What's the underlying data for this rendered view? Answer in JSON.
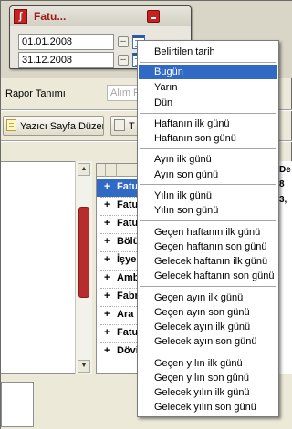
{
  "floating_window": {
    "title": "Fatu...",
    "date_from": "01.01.2008",
    "date_to": "31.12.2008",
    "dots": "..."
  },
  "filter": {
    "rapor_label": "Rapor Tanımı",
    "rapor_value": "Alım Fa"
  },
  "toolbar": {
    "print_page_setup": "Yazıcı Sayfa Düzeni",
    "second_button": "T"
  },
  "tree": {
    "rows": [
      {
        "plus": "+",
        "name": "Fatu"
      },
      {
        "plus": "+",
        "name": "Fatu"
      },
      {
        "plus": "+",
        "name": "Fatu"
      },
      {
        "plus": "+",
        "name": "Bölü"
      },
      {
        "plus": "+",
        "name": "İşye"
      },
      {
        "plus": "+",
        "name": "Amb"
      },
      {
        "plus": "+",
        "name": "Fabr"
      },
      {
        "plus": "+",
        "name": "Ara"
      },
      {
        "plus": "+",
        "name": "Fatu"
      },
      {
        "plus": "+",
        "name": "Dövi"
      }
    ]
  },
  "right_column": {
    "header": "De",
    "value_1": "8",
    "value_2": "3,"
  },
  "context_menu": {
    "items": [
      "Belirtilen tarih",
      "Bugün",
      "Yarın",
      "Dün",
      "Haftanın ilk günü",
      "Haftanın son günü",
      "Ayın ilk günü",
      "Ayın son günü",
      "Yılın ilk günü",
      "Yılın son günü",
      "Geçen haftanın ilk günü",
      "Geçen haftanın son günü",
      "Gelecek haftanın ilk günü",
      "Gelecek haftanın son günü",
      "Geçen ayın ilk günü",
      "Geçen ayın son günü",
      "Gelecek ayın ilk günü",
      "Gelecek ayın son günü",
      "Geçen yılın ilk günü",
      "Geçen yılın son günü",
      "Gelecek yılın ilk günü",
      "Gelecek yılın son günü"
    ],
    "highlighted": "Bugün"
  },
  "colors": {
    "highlight": "#316ac5",
    "window_title_text": "#a01818",
    "scroll_thumb": "#b72c2c"
  }
}
